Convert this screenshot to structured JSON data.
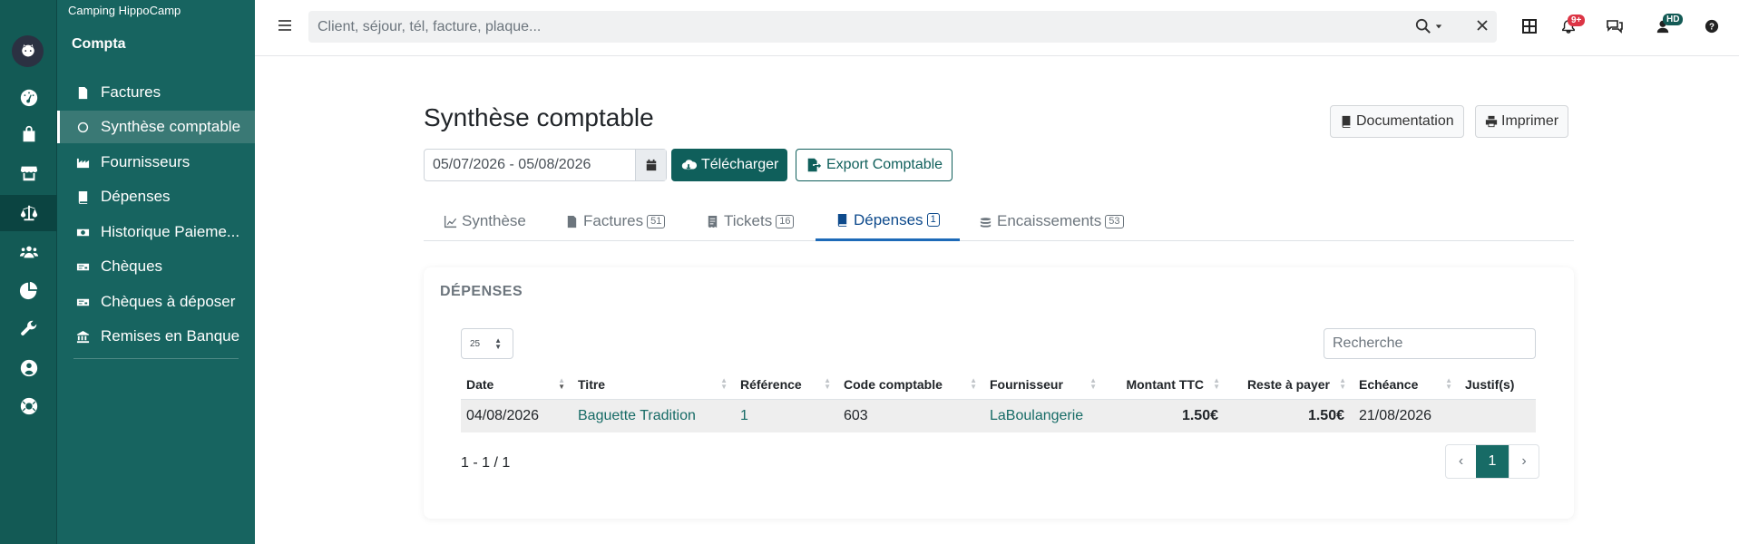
{
  "sidebar": {
    "camp_name": "Camping HippoCamp",
    "section_title": "Compta",
    "items": [
      {
        "label": "Factures",
        "icon": "file-invoice-icon"
      },
      {
        "label": "Synthèse comptable",
        "icon": "circle-icon"
      },
      {
        "label": "Fournisseurs",
        "icon": "industry-icon"
      },
      {
        "label": "Dépenses",
        "icon": "book-icon"
      },
      {
        "label": "Historique Paieme...",
        "icon": "money-bill-icon"
      },
      {
        "label": "Chèques",
        "icon": "money-check-icon"
      },
      {
        "label": "Chèques à déposer",
        "icon": "money-check-icon"
      },
      {
        "label": "Remises en Banque",
        "icon": "bank-icon"
      }
    ]
  },
  "rail": {
    "icons": [
      "dashboard-icon",
      "shopping-bag-icon",
      "store-icon",
      "balance-scale-icon",
      "users-icon",
      "pie-chart-icon",
      "wrench-icon",
      "user-circle-icon",
      "life-ring-icon"
    ]
  },
  "topbar": {
    "search_placeholder": "Client, séjour, tél, facture, plaque...",
    "notif_badge": "9+",
    "user_initials": "HD"
  },
  "page": {
    "title": "Synthèse comptable",
    "documentation_label": "Documentation",
    "print_label": "Imprimer",
    "date_range": "05/07/2026 - 05/08/2026",
    "download_label": "Télécharger",
    "export_label": "Export Comptable"
  },
  "tabs": [
    {
      "label": "Synthèse",
      "count": null
    },
    {
      "label": "Factures",
      "count": "51"
    },
    {
      "label": "Tickets",
      "count": "16"
    },
    {
      "label": "Dépenses",
      "count": "1"
    },
    {
      "label": "Encaissements",
      "count": "53"
    }
  ],
  "card": {
    "title": "DÉPENSES",
    "page_length": "25",
    "search_placeholder": "Recherche",
    "columns": [
      "Date",
      "Titre",
      "Référence",
      "Code comptable",
      "Fournisseur",
      "Montant TTC",
      "Reste à payer",
      "Echéance",
      "Justif(s)"
    ],
    "rows": [
      {
        "date": "04/08/2026",
        "titre": "Baguette Tradition",
        "reference": "1",
        "code": "603",
        "fournisseur": "LaBoulangerie",
        "montant": "1.50€",
        "reste": "1.50€",
        "echeance": "21/08/2026",
        "justif": ""
      }
    ],
    "info": "1 - 1 / 1",
    "pager": {
      "prev": "‹",
      "current": "1",
      "next": "›"
    }
  },
  "colors": {
    "rail_bg": "#135a55",
    "sidebar_bg": "#176460",
    "accent": "#0f5f5b",
    "active_tab": "#1d6ab8",
    "badge_red": "#dc3545"
  }
}
